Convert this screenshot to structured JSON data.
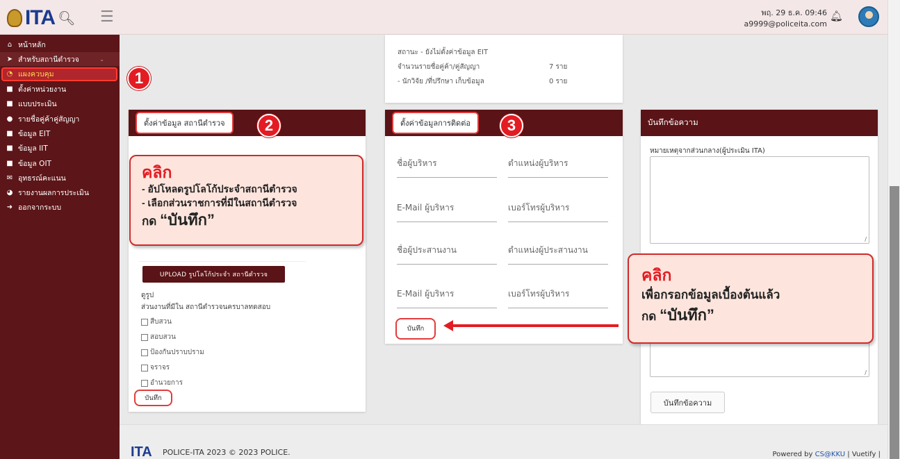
{
  "header": {
    "logo_text": "ITA",
    "user_date": "พฤ. 29 ธ.ค. 09:46",
    "user_email": "a9999@policeita.com"
  },
  "sidebar": {
    "items": [
      {
        "label": "หน้าหลัก",
        "icon": "home-icon"
      },
      {
        "label": "สำหรับสถานีตำรวจ",
        "icon": "chevron-circle-icon"
      },
      {
        "label": "แผงควบคุม",
        "icon": "dashboard-icon"
      },
      {
        "label": "ตั้งค่าหน่วยงาน",
        "icon": "briefcase-icon"
      },
      {
        "label": "แบบประเมิน",
        "icon": "briefcase-icon"
      },
      {
        "label": "รายชื่อคู่ค้าคู่สัญญา",
        "icon": "users-icon"
      },
      {
        "label": "ข้อมูล EIT",
        "icon": "briefcase-icon"
      },
      {
        "label": "ข้อมูล IIT",
        "icon": "briefcase-icon"
      },
      {
        "label": "ข้อมูล OIT",
        "icon": "briefcase-icon"
      },
      {
        "label": "อุทธรณ์คะแนน",
        "icon": "envelope-icon"
      },
      {
        "label": "รายงานผลการประเมิน",
        "icon": "pie-chart-icon"
      },
      {
        "label": "ออกจากระบบ",
        "icon": "logout-icon"
      }
    ]
  },
  "status": {
    "line1": "สถานะ - ยังไม่ตั้งค่าข้อมูล EIT",
    "line2_label": "จำนวนรายชื่อคู่ค้า/คู่สัญญา",
    "line2_value": "7 ราย",
    "line3_label": "- นักวิจัย /ที่ปรึกษา เก็บข้อมูล",
    "line3_value": "0 ราย"
  },
  "card_station": {
    "header": "ตั้งค่าข้อมูล สถานีตำรวจ",
    "badge": "2",
    "upload_label": "UPLOAD รูปโลโก้ประจำ สถานีตำรวจ",
    "view_image": "ดูรูป",
    "units_label": "ส่วนงานที่มีใน สถานีตำรวจนครบาลทดสอบ",
    "checkboxes": [
      "สืบสวน",
      "สอบสวน",
      "ป้องกันปราบปราม",
      "จราจร",
      "อำนวยการ"
    ],
    "save_label": "บันทึก"
  },
  "card_contact": {
    "header": "ตั้งค่าข้อมูลการติดต่อ",
    "badge": "3",
    "fields": [
      "ชื่อผู้บริหาร",
      "ตำแหน่งผู้บริหาร",
      "E-Mail ผู้บริหาร",
      "เบอร์โทรผู้บริหาร",
      "ชื่อผู้ประสานงาน",
      "ตำแหน่งผู้ประสานงาน",
      "E-Mail ผู้บริหาร",
      "เบอร์โทรผู้บริหาร"
    ],
    "save_label": "บันทึก"
  },
  "card_notes": {
    "header": "บันทึกข้อความ",
    "note_label": "หมายเหตุจากส่วนกลาง(ผู้ประเมิน ITA)",
    "save_label": "บันทึกข้อความ"
  },
  "badge1": "1",
  "callout_left": {
    "title": "คลิก",
    "line1": "-  อัปโหลดรูปโลโก้ประจำสถานีตำรวจ",
    "line2": "-  เลือกส่วนราชการที่มีในสถานีตำรวจ",
    "line3_prefix": "กด",
    "line3_bold": "“บันทึก”"
  },
  "callout_right": {
    "title": "คลิก",
    "line1": "เพื่อกรอกข้อมูลเบื้องต้นแล้ว",
    "line2_prefix": "กด",
    "line2_bold": "“บันทึก”"
  },
  "footer": {
    "logo_text": "ITA",
    "copyright": "POLICE-ITA 2023 © 2023 POLICE.",
    "powered_prefix": "Powered by",
    "powered_link": "CS@KKU",
    "powered_suffix": "| Vuetify |"
  },
  "colors": {
    "sidebar_bg": "#5c1518",
    "card_header": "#5a1316",
    "highlight_red": "#e31c23",
    "callout_bg": "#fde5dd"
  }
}
